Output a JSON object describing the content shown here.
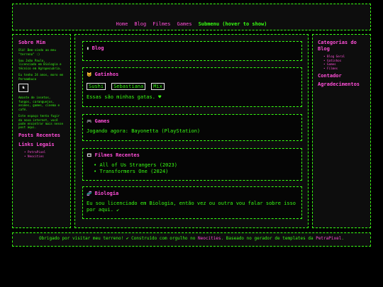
{
  "nav": {
    "home": "Home",
    "blog": "Blog",
    "films": "Filmes",
    "games": "Games",
    "submenu": "Submenu (hover to show)"
  },
  "left": {
    "about_title": "Sobre Mim",
    "intro": "Olá! Bem-vindo ao meu \"terreno\" :)",
    "bio": "Sou João Paulo, licenciado em Biologia e técnico em Agropecuária.",
    "age": "Eu tenho 24 anos, moro em Pernambuco",
    "badge_icon": "chess-knight-icon",
    "interests": "Amante de insetos, fungos, caranguejos, animes, games, cinema e café.",
    "space": "Este espaço tenta fugir da nova internet, você pode encontrar mais nesse post aqui.",
    "posts_title": "Posts Recentes",
    "links_title": "Links Legais",
    "links": [
      "PetraPixel",
      "Neocities"
    ]
  },
  "boxes": {
    "blog_title": "Blog",
    "cats_title": "Gatinhos",
    "cats": [
      "Sushi",
      "Sebastiana",
      "Mix"
    ],
    "cats_caption": "Essas são minhas gatas. ♥",
    "games_title": "Games",
    "games_text": "Jogando agora: Bayonetta (PlayStation)",
    "films_title": "Filmes Recentes",
    "films": [
      "All of Us Strangers (2023)",
      "Transformers One (2024)"
    ],
    "bio_title": "Biologia",
    "bio_text": "Eu sou licenciado em Biologia, então vez ou outra vou falar sobre isso por aqui. ↙"
  },
  "right": {
    "categories_title": "Categorias do Blog",
    "categories": [
      "Blog Geral",
      "Gatinhos",
      "Games",
      "Filmes"
    ],
    "contact": "Contador",
    "thanks": "Agradecimentos"
  },
  "footer": {
    "line1": "Obrigado por visitar meu terreno! ✔ Construído com orgulho no",
    "neocities": "Neocities",
    "line2": ". Baseado no gerador de templates da",
    "petra": "PetraPixel",
    "end": "."
  }
}
